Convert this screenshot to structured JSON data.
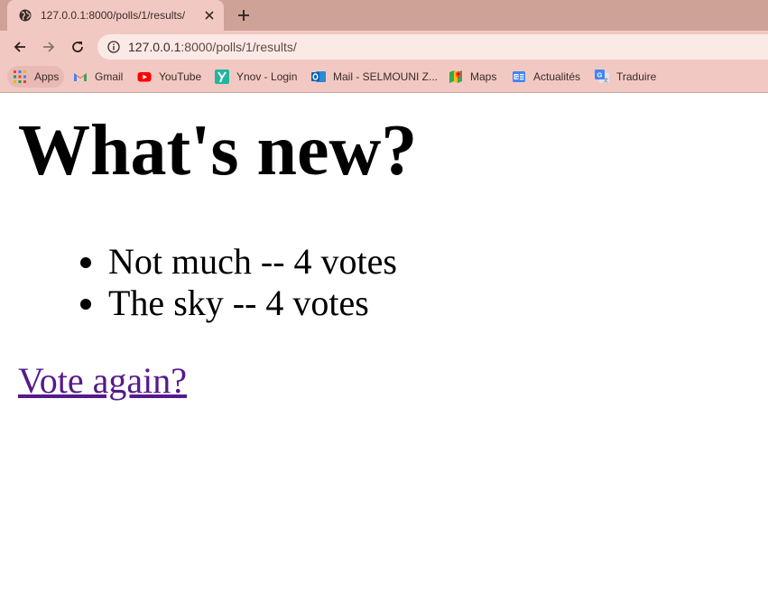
{
  "browser": {
    "tab": {
      "title": "127.0.0.1:8000/polls/1/results/",
      "favicon": "globe-icon",
      "close_icon": "close-icon"
    },
    "new_tab_icon": "plus-icon",
    "toolbar": {
      "back_icon": "back-arrow-icon",
      "forward_icon": "forward-arrow-icon",
      "reload_icon": "reload-icon",
      "site_info_icon": "info-icon",
      "url_host": "127.0.0.1",
      "url_rest": ":8000/polls/1/results/"
    },
    "bookmarks": [
      {
        "label": "Apps",
        "icon": "apps-grid-icon"
      },
      {
        "label": "Gmail",
        "icon": "gmail-icon"
      },
      {
        "label": "YouTube",
        "icon": "youtube-icon"
      },
      {
        "label": "Ynov - Login",
        "icon": "ynov-icon"
      },
      {
        "label": "Mail - SELMOUNI Z...",
        "icon": "outlook-icon"
      },
      {
        "label": "Maps",
        "icon": "maps-icon"
      },
      {
        "label": "Actualités",
        "icon": "news-icon"
      },
      {
        "label": "Traduire",
        "icon": "translate-icon"
      }
    ],
    "colors": {
      "tabstrip": "#cfa298",
      "toolbar": "#f2c9c2",
      "omnibox": "#fbe9e6"
    }
  },
  "page": {
    "heading": "What's new?",
    "results": [
      "Not much -- 4 votes",
      "The sky -- 4 votes"
    ],
    "vote_again_link": "Vote again?",
    "colors": {
      "link_visited": "#551a8b"
    }
  }
}
